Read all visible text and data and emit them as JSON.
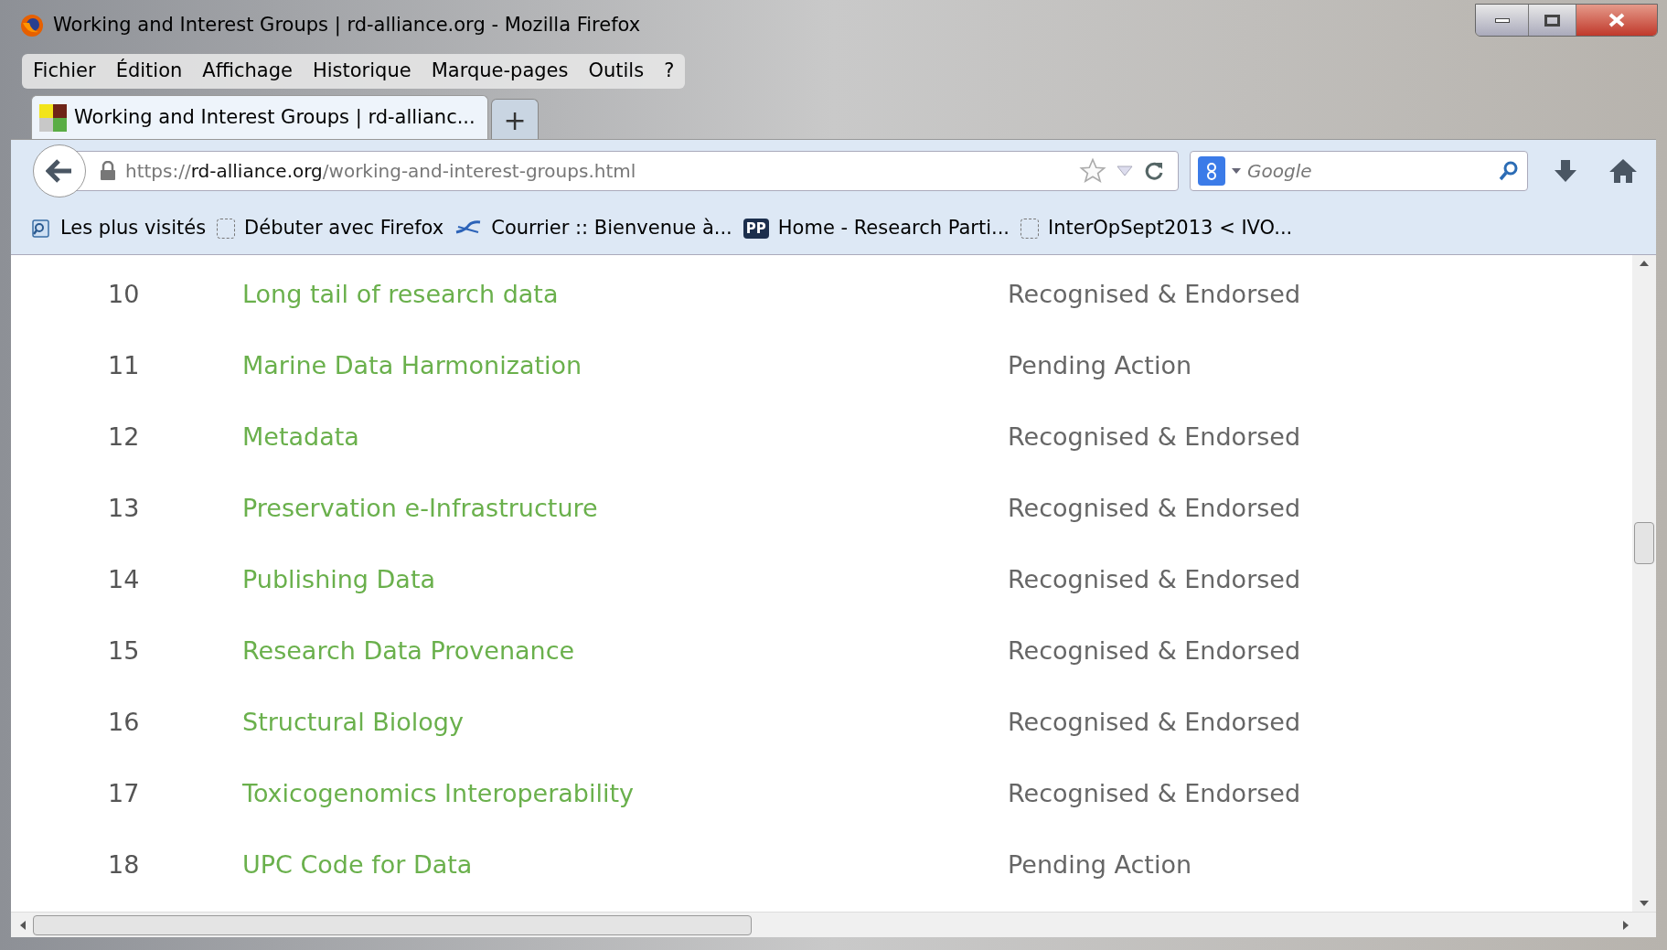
{
  "window": {
    "title": "Working and Interest Groups | rd-alliance.org - Mozilla Firefox"
  },
  "menu": [
    "Fichier",
    "Édition",
    "Affichage",
    "Historique",
    "Marque-pages",
    "Outils",
    "?"
  ],
  "tabs": [
    {
      "label": "Working and Interest Groups | rd-allianc...",
      "selected": true
    }
  ],
  "new_tab": "+",
  "url": {
    "scheme": "https://",
    "host": "rd-alliance.org",
    "path": "/working-and-interest-groups.html"
  },
  "search": {
    "placeholder": "Google"
  },
  "bookmarks": [
    {
      "kind": "most",
      "label": "Les plus visités"
    },
    {
      "kind": "blank",
      "label": "Débuter avec Firefox"
    },
    {
      "kind": "mail",
      "label": "Courrier :: Bienvenue à..."
    },
    {
      "kind": "pp",
      "label": "Home - Research Parti...",
      "badge": "PP"
    },
    {
      "kind": "blank",
      "label": "InterOpSept2013 < IVO..."
    }
  ],
  "groups": [
    {
      "number": "10",
      "name": "Long tail of research data",
      "status": "Recognised & Endorsed"
    },
    {
      "number": "11",
      "name": "Marine Data Harmonization",
      "status": "Pending Action"
    },
    {
      "number": "12",
      "name": "Metadata",
      "status": "Recognised & Endorsed"
    },
    {
      "number": "13",
      "name": "Preservation e-Infrastructure",
      "status": "Recognised & Endorsed"
    },
    {
      "number": "14",
      "name": "Publishing Data",
      "status": "Recognised & Endorsed"
    },
    {
      "number": "15",
      "name": "Research Data Provenance",
      "status": "Recognised & Endorsed"
    },
    {
      "number": "16",
      "name": "Structural Biology",
      "status": "Recognised & Endorsed"
    },
    {
      "number": "17",
      "name": "Toxicogenomics Interoperability",
      "status": "Recognised & Endorsed"
    },
    {
      "number": "18",
      "name": "UPC Code for Data",
      "status": "Pending Action"
    }
  ]
}
